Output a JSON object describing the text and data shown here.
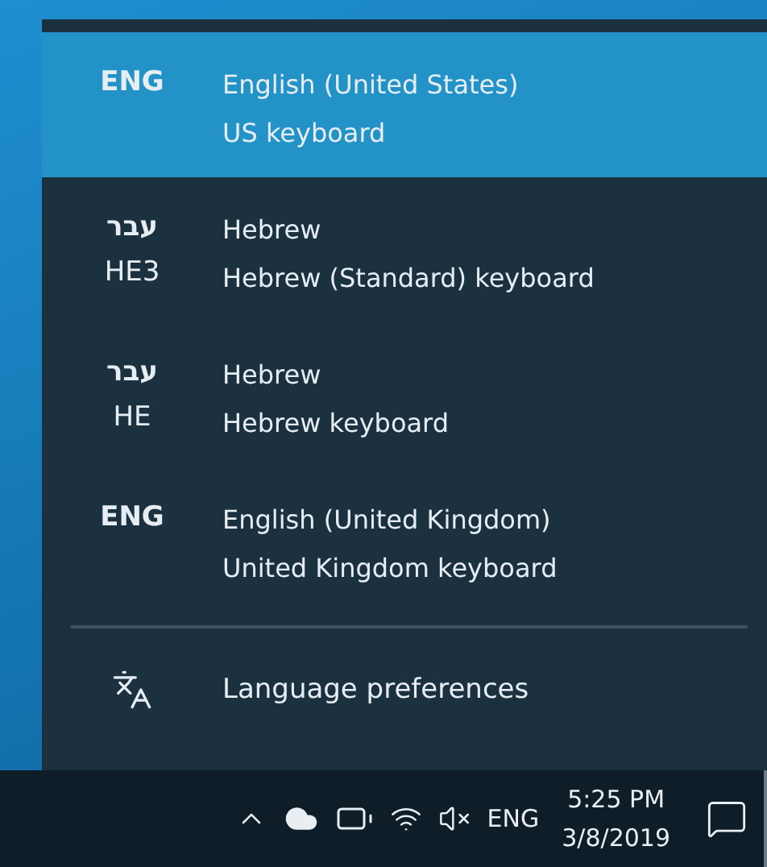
{
  "languages": [
    {
      "badge": "ENG",
      "name": "English (United States)",
      "keyboard": "US keyboard",
      "selected": true
    },
    {
      "badge": "עבר",
      "badge_sub": "HE3",
      "name": "Hebrew",
      "keyboard": "Hebrew (Standard) keyboard",
      "selected": false
    },
    {
      "badge": "עבר",
      "badge_sub": "HE",
      "name": "Hebrew",
      "keyboard": "Hebrew keyboard",
      "selected": false
    },
    {
      "badge": "ENG",
      "name": "English (United Kingdom)",
      "keyboard": "United Kingdom keyboard",
      "selected": false
    }
  ],
  "preferences_link": "Language preferences",
  "taskbar": {
    "input_indicator": "ENG",
    "time": "5:25 PM",
    "date": "3/8/2019"
  }
}
